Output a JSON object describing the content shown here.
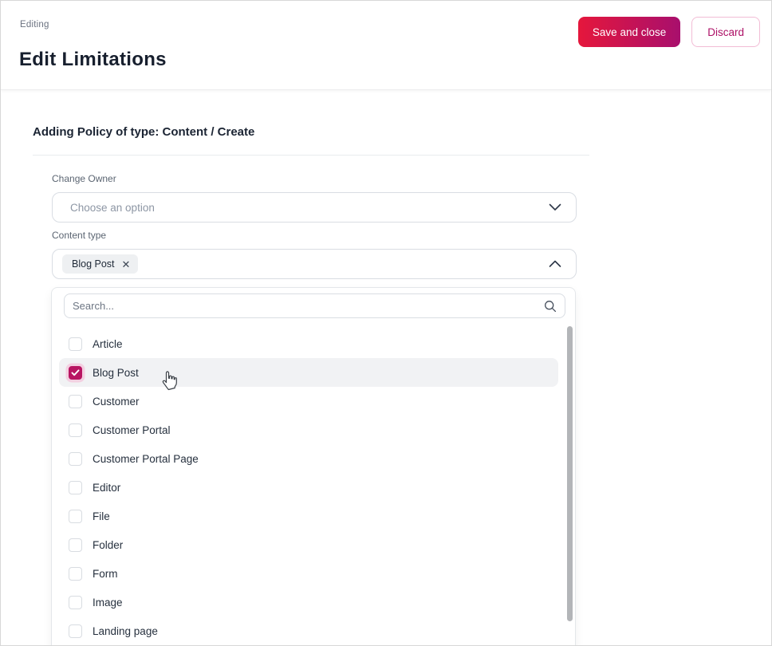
{
  "page": {
    "eyebrow": "Editing",
    "title": "Edit Limitations"
  },
  "actions": {
    "save": "Save and close",
    "discard": "Discard"
  },
  "section": {
    "title": "Adding Policy of type: Content / Create"
  },
  "form": {
    "change_owner": {
      "label": "Change Owner",
      "placeholder": "Choose an option"
    },
    "content_type": {
      "label": "Content type",
      "chips": [
        {
          "label": "Blog Post",
          "remove": "✕"
        }
      ]
    }
  },
  "dropdown": {
    "search_placeholder": "Search...",
    "options": [
      {
        "label": "Article",
        "checked": false,
        "highlighted": false
      },
      {
        "label": "Blog Post",
        "checked": true,
        "highlighted": true
      },
      {
        "label": "Customer",
        "checked": false,
        "highlighted": false
      },
      {
        "label": "Customer Portal",
        "checked": false,
        "highlighted": false
      },
      {
        "label": "Customer Portal Page",
        "checked": false,
        "highlighted": false
      },
      {
        "label": "Editor",
        "checked": false,
        "highlighted": false
      },
      {
        "label": "File",
        "checked": false,
        "highlighted": false
      },
      {
        "label": "Folder",
        "checked": false,
        "highlighted": false
      },
      {
        "label": "Form",
        "checked": false,
        "highlighted": false
      },
      {
        "label": "Image",
        "checked": false,
        "highlighted": false
      },
      {
        "label": "Landing page",
        "checked": false,
        "highlighted": false
      }
    ]
  },
  "colors": {
    "accent_gradient_start": "#e5173c",
    "accent_gradient_end": "#a80f6d",
    "accent_text": "#ad1066",
    "checkbox_checked": "#b81562",
    "checkbox_halo": "#f3d0e1",
    "row_highlight": "#f1f2f4",
    "title_text": "#171f2e"
  }
}
